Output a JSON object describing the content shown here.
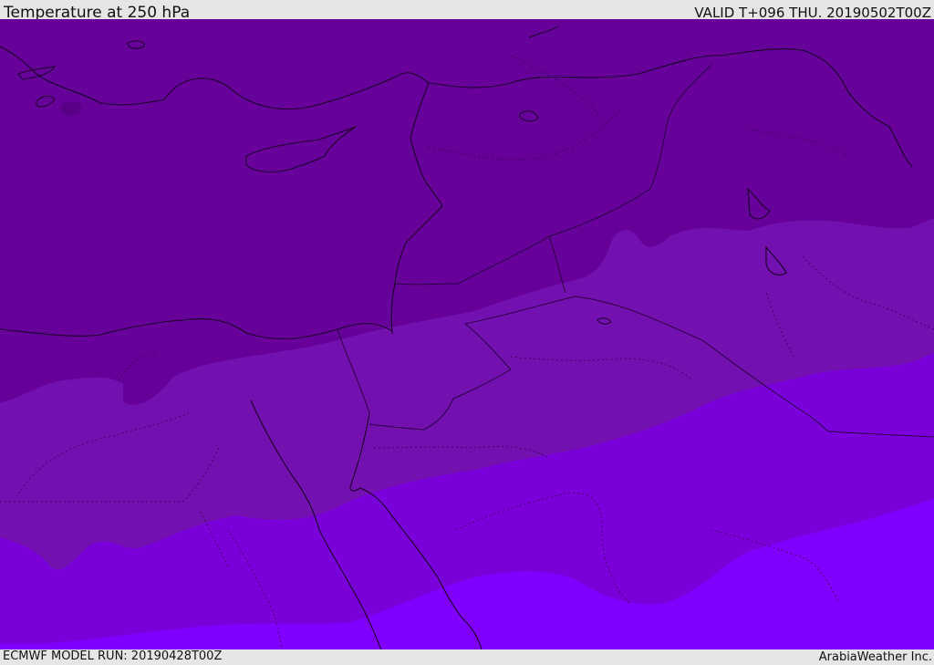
{
  "header": {
    "title": "Temperature at 250 hPa",
    "valid_time": "VALID T+096 THU. 20190502T00Z"
  },
  "footer": {
    "model_run": "ECMWF MODEL RUN: 20190428T00Z",
    "credit": "ArabiaWeather Inc."
  },
  "map": {
    "colors": {
      "band_coldest": "#660099",
      "band_cold": "#7311b0",
      "band_mid": "#7a00d9",
      "band_warm": "#8000ff",
      "coastline": "#1a0026",
      "border": "#2a0040"
    }
  }
}
